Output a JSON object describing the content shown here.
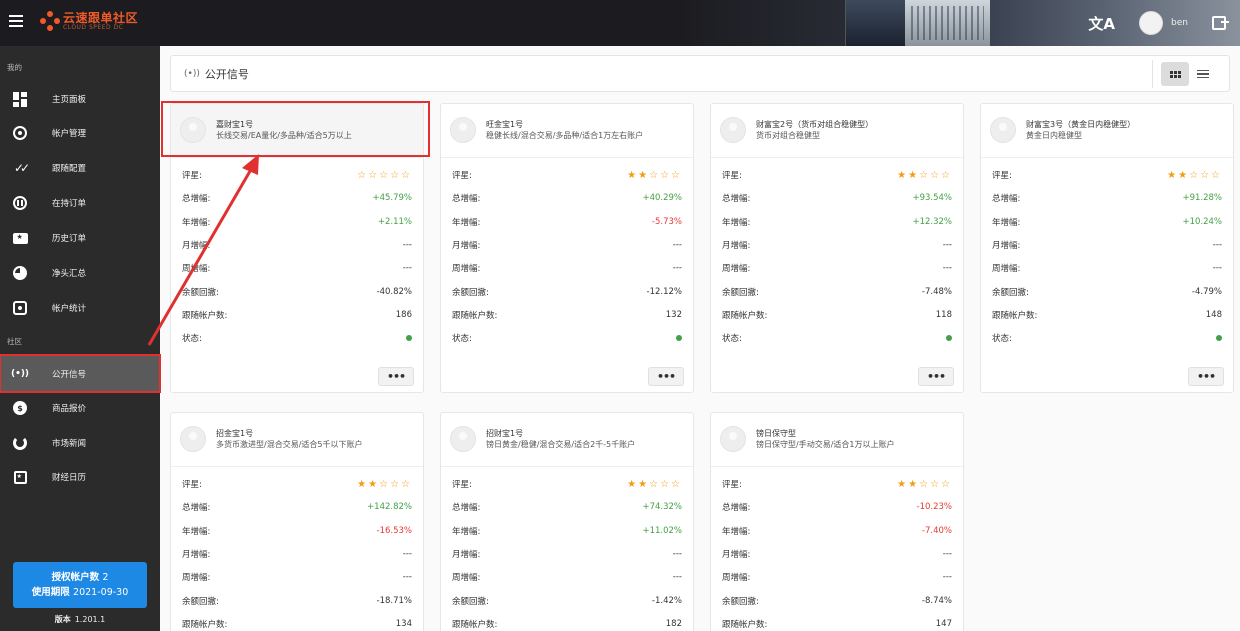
{
  "app": {
    "logo_cn": "云速跟单社区",
    "logo_en": "CLOUD SPEED DC",
    "username": "ben"
  },
  "sidebar": {
    "section_mine": "我的",
    "section_community": "社区",
    "items": [
      {
        "label": "主页面板",
        "icon": "dashboard-icon"
      },
      {
        "label": "帐户管理",
        "icon": "account-icon"
      },
      {
        "label": "跟随配置",
        "icon": "double-check-icon"
      },
      {
        "label": "在持订单",
        "icon": "pause-circle-icon"
      },
      {
        "label": "历史订单",
        "icon": "ticket-icon"
      },
      {
        "label": "净头汇总",
        "icon": "pie-icon"
      },
      {
        "label": "帐户统计",
        "icon": "stats-icon"
      },
      {
        "label": "公开信号",
        "icon": "signal-icon"
      },
      {
        "label": "商品报价",
        "icon": "coin-icon"
      },
      {
        "label": "市场新闻",
        "icon": "ring-icon"
      },
      {
        "label": "财经日历",
        "icon": "calendar-icon"
      }
    ],
    "license_label": "授权帐户数",
    "license_count": "2",
    "expire_label": "使用期限",
    "expire_date": "2021-09-30",
    "version_label": "版本",
    "version_value": "1.201.1"
  },
  "header": {
    "signal_glyph": "(•))",
    "title": "公开信号"
  },
  "labels": {
    "rating": "评星:",
    "total": "总增幅:",
    "year": "年增幅:",
    "month": "月增幅:",
    "week": "周增幅:",
    "drawdown": "余额回撤:",
    "followers": "跟随帐户数:",
    "status": "状态:",
    "more": "•••"
  },
  "cards": [
    {
      "name": "嘉财宝1号",
      "desc": "长线交易/EA量化/多品种/适合5万以上",
      "stars": 0,
      "total": "+45.79%",
      "total_sign": "pos",
      "year": "+2.11%",
      "year_sign": "pos",
      "month": "---",
      "week": "---",
      "drawdown": "-40.82%",
      "followers": "186"
    },
    {
      "name": "旺金宝1号",
      "desc": "稳健长线/混合交易/多品种/适合1万左右账户",
      "stars": 2,
      "total": "+40.29%",
      "total_sign": "pos",
      "year": "-5.73%",
      "year_sign": "neg",
      "month": "---",
      "week": "---",
      "drawdown": "-12.12%",
      "followers": "132"
    },
    {
      "name": "财富宝2号（货币对组合稳健型）",
      "desc": "货币对组合稳健型",
      "stars": 2,
      "total": "+93.54%",
      "total_sign": "pos",
      "year": "+12.32%",
      "year_sign": "pos",
      "month": "---",
      "week": "---",
      "drawdown": "-7.48%",
      "followers": "118"
    },
    {
      "name": "财富宝3号（黄金日内稳健型）",
      "desc": "黄金日内稳健型",
      "stars": 2,
      "total": "+91.28%",
      "total_sign": "pos",
      "year": "+10.24%",
      "year_sign": "pos",
      "month": "---",
      "week": "---",
      "drawdown": "-4.79%",
      "followers": "148"
    },
    {
      "name": "招金宝1号",
      "desc": "多货币激进型/混合交易/适合5千以下账户",
      "stars": 2,
      "total": "+142.82%",
      "total_sign": "pos",
      "year": "-16.53%",
      "year_sign": "neg",
      "month": "---",
      "week": "---",
      "drawdown": "-18.71%",
      "followers": "134"
    },
    {
      "name": "招财宝1号",
      "desc": "镑日黄金/稳健/混合交易/适合2千-5千账户",
      "stars": 2,
      "total": "+74.32%",
      "total_sign": "pos",
      "year": "+11.02%",
      "year_sign": "pos",
      "month": "---",
      "week": "---",
      "drawdown": "-1.42%",
      "followers": "182"
    },
    {
      "name": "镑日保守型",
      "desc": "镑日保守型/手动交易/适合1万以上账户",
      "stars": 2,
      "total": "-10.23%",
      "total_sign": "neg",
      "year": "-7.40%",
      "year_sign": "neg",
      "month": "---",
      "week": "---",
      "drawdown": "-8.74%",
      "followers": "147"
    }
  ],
  "colors": {
    "accent": "#1e88e5",
    "positive": "#43a047",
    "negative": "#e53935",
    "star": "#f39c12",
    "annotation": "#e03030"
  }
}
